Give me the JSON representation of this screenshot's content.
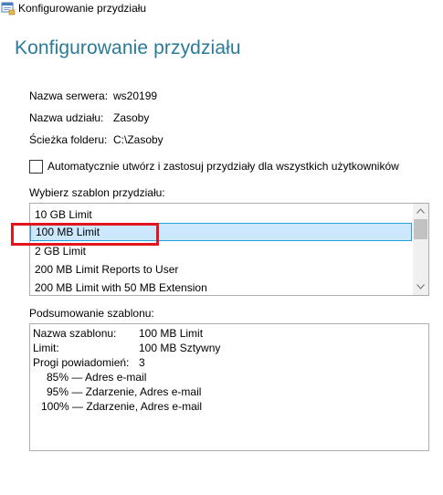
{
  "window": {
    "title": "Konfigurowanie przydziału"
  },
  "page": {
    "heading": "Konfigurowanie przydziału"
  },
  "info": {
    "server_label": "Nazwa serwera:",
    "server_value": "ws20199",
    "share_label": "Nazwa udziału:",
    "share_value": "Zasoby",
    "path_label": "Ścieżka folderu:",
    "path_value": "C:\\Zasoby"
  },
  "auto_checkbox": {
    "label": "Automatycznie utwórz i zastosuj przydziały dla wszystkich użytkowników",
    "checked": false
  },
  "template_list": {
    "label": "Wybierz szablon przydziału:",
    "items": [
      "10 GB Limit",
      "100 MB Limit",
      "2 GB Limit",
      "200 MB Limit Reports to User",
      "200 MB Limit with 50 MB Extension"
    ],
    "selected": "100 MB Limit"
  },
  "summary": {
    "label": "Podsumowanie szablonu:",
    "name_label": "Nazwa szablonu:",
    "name_value": "100 MB Limit",
    "limit_label": "Limit:",
    "limit_value": "100 MB Sztywny",
    "thresholds_label": "Progi powiadomień:",
    "thresholds_count": "3",
    "thresholds": [
      "85% — Adres e-mail",
      "95% — Zdarzenie, Adres e-mail",
      "100% — Zdarzenie, Adres e-mail"
    ]
  },
  "colors": {
    "heading": "#2a7a9a",
    "selection_bg": "#cce8ff",
    "selection_border": "#26a0da",
    "highlight_annotation": "#e0151e"
  },
  "icons": {
    "app_icon": "quota-window-icon",
    "scroll_up": "chevron-up-icon",
    "scroll_down": "chevron-down-icon"
  }
}
